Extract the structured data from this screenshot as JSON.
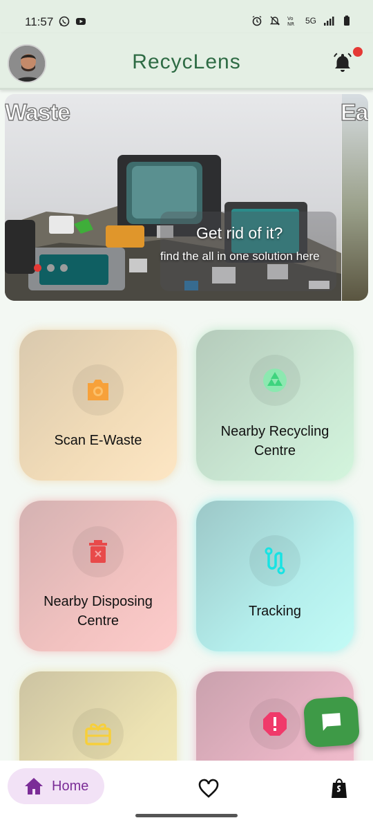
{
  "status_bar": {
    "time": "11:57",
    "network_label": "5G",
    "left_icons": [
      "whatsapp-icon",
      "youtube-icon"
    ],
    "right_icons": [
      "alarm-icon",
      "notifications-off-icon",
      "vowifi-icon",
      "signal-icon",
      "battery-icon"
    ]
  },
  "app_bar": {
    "title": "RecycLens",
    "title_color": "#2e6b44",
    "notification_dot_color": "#e53935"
  },
  "carousel": {
    "slide_word": "Waste",
    "next_slide_word": "Ea",
    "caption_heading": "Get rid of it?",
    "caption_text": "find the all in one solution here",
    "dots": 3,
    "active_dot": 0,
    "active_dot_color": "#e53935"
  },
  "cards": [
    {
      "label": "Scan E-Waste",
      "icon": "camera-icon",
      "icon_color": "#f7a13a"
    },
    {
      "label": "Nearby Recycling Centre",
      "icon": "recycle-icon",
      "icon_color": "#5fe08f"
    },
    {
      "label": "Nearby Disposing Centre",
      "icon": "delete-bin-icon",
      "icon_color": "#e84a4a"
    },
    {
      "label": "Tracking",
      "icon": "route-icon",
      "icon_color": "#18e3e3"
    },
    {
      "label": "",
      "icon": "redeem-gift-icon",
      "icon_color": "#f7cf3a"
    },
    {
      "label": "",
      "icon": "report-alert-icon",
      "icon_color": "#f03a6a"
    }
  ],
  "fab": {
    "icon": "chat-icon",
    "color": "#3e9a47"
  },
  "bottom_nav": {
    "home_label": "Home",
    "active_color": "#7b2d97",
    "items": [
      "home-icon",
      "heart-icon",
      "shopping-bag-icon"
    ]
  }
}
